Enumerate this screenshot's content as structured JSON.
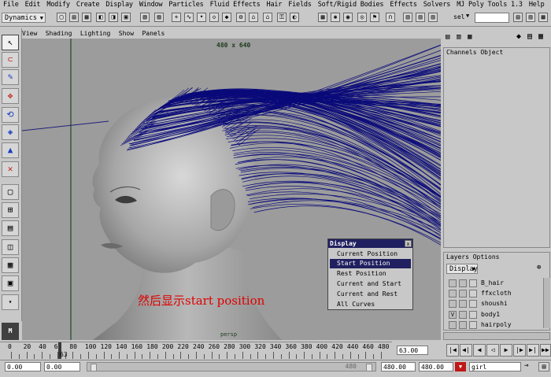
{
  "menubar": [
    "File",
    "Edit",
    "Modify",
    "Create",
    "Display",
    "Window",
    "Particles",
    "Fluid Effects",
    "Hair",
    "Fields",
    "Soft/Rigid Bodies",
    "Effects",
    "Solvers",
    "MJ Poly Tools 1.3",
    "Help"
  ],
  "shelf": {
    "mode_select": "Dynamics",
    "sel_label": "sel"
  },
  "viewport": {
    "menu": [
      "View",
      "Shading",
      "Lighting",
      "Show",
      "Panels"
    ],
    "resolution": "480 x 640",
    "camera": "persp",
    "annotation": "然后显示start position"
  },
  "popup": {
    "title": "Display",
    "close": "x",
    "items": [
      "Current Position",
      "Start Position",
      "Rest Position",
      "Current and Start",
      "Current and Rest",
      "All Curves"
    ],
    "highlighted_index": 1
  },
  "channels": {
    "tabs": [
      "Channels",
      "Object"
    ]
  },
  "layers": {
    "tabs": [
      "Layers",
      "Options"
    ],
    "select": "Display",
    "rows": [
      {
        "name": "B_hair",
        "visible": ""
      },
      {
        "name": "ffxcloth",
        "visible": ""
      },
      {
        "name": "shoushi",
        "visible": ""
      },
      {
        "name": "body1",
        "visible": "V"
      },
      {
        "name": "hairpoly",
        "visible": ""
      }
    ]
  },
  "timeline": {
    "ticks": [
      "0",
      "20",
      "40",
      "60",
      "80",
      "100",
      "120",
      "140",
      "160",
      "180",
      "200",
      "220",
      "240",
      "260",
      "280",
      "300",
      "320",
      "340",
      "360",
      "380",
      "400",
      "420",
      "440",
      "460",
      "480"
    ],
    "marker": "63",
    "current_frame": "63.00"
  },
  "range": {
    "start": "0.00",
    "playback_start": "0.00",
    "slider_end": "480",
    "playback_end": "480.00",
    "end": "480.00",
    "character": "girl"
  },
  "colors": {
    "hair": "#0a0a7a",
    "highlight": "#202060",
    "annotation": "#e00000"
  }
}
